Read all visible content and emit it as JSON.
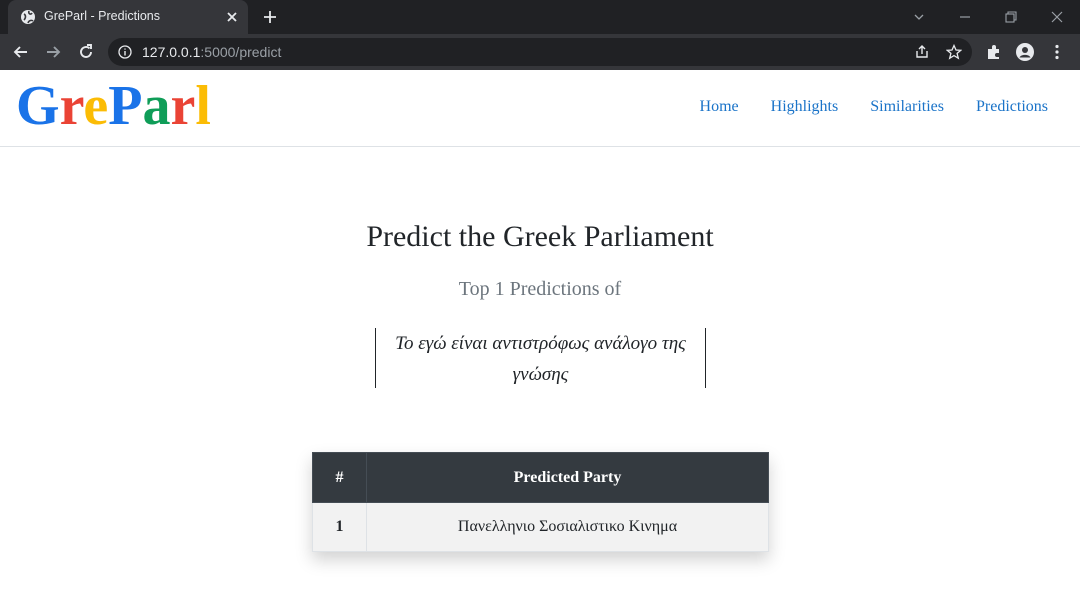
{
  "browser": {
    "tab_title": "GreParl - Predictions",
    "url_host": "127.0.0.1",
    "url_path": ":5000/predict"
  },
  "logo": {
    "letters": [
      {
        "char": "G",
        "color": "#1a73e8"
      },
      {
        "char": "r",
        "color": "#ea4335"
      },
      {
        "char": "e",
        "color": "#fbbc05"
      },
      {
        "char": "P",
        "color": "#1a73e8"
      },
      {
        "char": "a",
        "color": "#0f9d58"
      },
      {
        "char": "r",
        "color": "#ea4335"
      },
      {
        "char": "l",
        "color": "#fbbc05"
      }
    ]
  },
  "nav": {
    "home": "Home",
    "highlights": "Highlights",
    "similarities": "Similarities",
    "predictions": "Predictions"
  },
  "main": {
    "title": "Predict the Greek Parliament",
    "subtitle": "Top 1 Predictions of",
    "quote": "Το εγώ είναι αντιστρόφως ανάλογο της γνώσης"
  },
  "table": {
    "headers": [
      "#",
      "Predicted Party"
    ],
    "rows": [
      [
        "1",
        "Πανελληνιο Σοσιαλιστικο Κινημα"
      ]
    ]
  }
}
